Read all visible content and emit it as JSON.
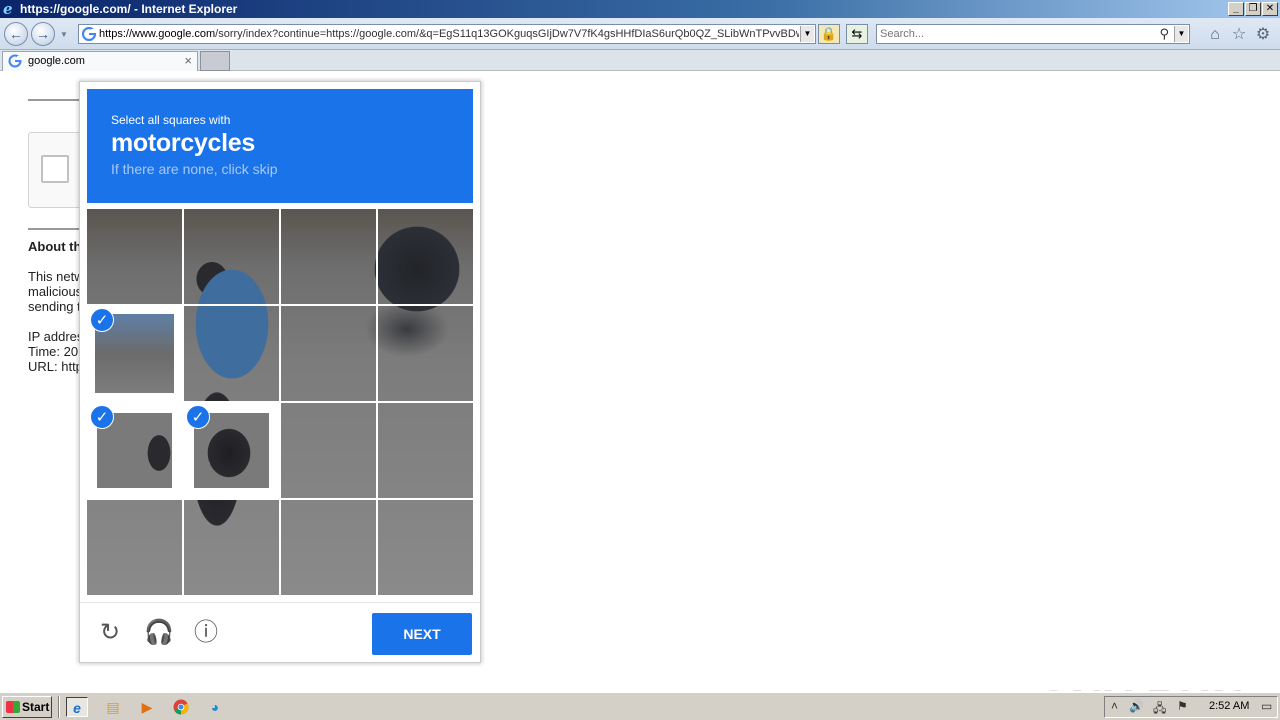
{
  "window": {
    "title": "https://google.com/ - Internet Explorer"
  },
  "address_bar": {
    "url_host": "https://www.google.com",
    "url_rest": "/sorry/index?continue=https://google.com/&q=EgS11q13GOKguqsGIjDw7V7fK4gsHHfDIaS6urQb0QZ_SLibWnTPvvBDwb"
  },
  "search_box": {
    "placeholder": "Search..."
  },
  "tabs": [
    {
      "label": "google.com"
    }
  ],
  "page": {
    "about_heading": "About th",
    "body_lines": [
      "This netw",
      "malicious",
      "sending t"
    ],
    "ip_line": "IP addres",
    "time_line": "Time: 20",
    "url_line": "URL: http"
  },
  "challenge": {
    "instruction_top": "Select all squares with",
    "target_object": "motorcycles",
    "instruction_sub": "If there are none, click skip",
    "next_label": "NEXT",
    "selected_tiles": [
      {
        "row": 1,
        "col": 0
      },
      {
        "row": 2,
        "col": 0
      },
      {
        "row": 2,
        "col": 1
      }
    ],
    "grid_size": "4x4",
    "colors": {
      "accent": "#1a73e8"
    }
  },
  "watermark": {
    "text": "ANY RUN"
  },
  "taskbar": {
    "start_label": "Start",
    "clock": "2:52 AM"
  }
}
